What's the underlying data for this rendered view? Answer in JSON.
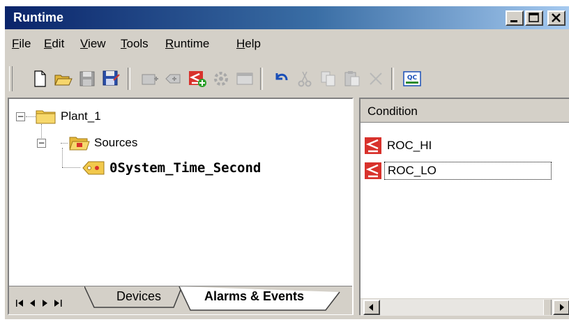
{
  "window": {
    "title": "Runtime"
  },
  "menu": [
    {
      "pre": "",
      "u": "F",
      "post": "ile"
    },
    {
      "pre": "",
      "u": "E",
      "post": "dit"
    },
    {
      "pre": "",
      "u": "V",
      "post": "iew"
    },
    {
      "pre": "",
      "u": "T",
      "post": "ools"
    },
    {
      "pre": "",
      "u": "R",
      "post": "untime"
    },
    {
      "pre": "",
      "u": "H",
      "post": "elp"
    }
  ],
  "tree": {
    "root": "Plant_1",
    "sources": "Sources",
    "item": "0System_Time_Second"
  },
  "tabs": {
    "devices": "Devices",
    "alarms": "Alarms & Events"
  },
  "conditions": {
    "header": "Condition",
    "rows": [
      "ROC_HI",
      "ROC_LO"
    ]
  },
  "colors": {
    "title_start": "#0a246a",
    "title_end": "#a6caf0",
    "alarm_icon": "#d8322c",
    "face": "#d4d0c8"
  }
}
